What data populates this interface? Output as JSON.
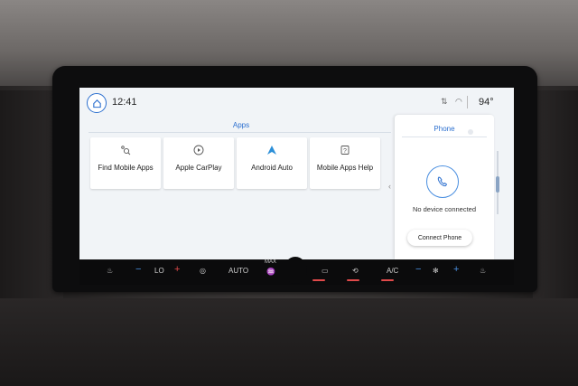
{
  "status_bar": {
    "time": "12:41",
    "temperature": "94°",
    "home_icon": "home-icon",
    "signal_icons": "⇅ ◠"
  },
  "apps_section": {
    "title": "Apps",
    "tiles": [
      {
        "label": "Find Mobile Apps",
        "icon": "search-apps-icon"
      },
      {
        "label": "Apple CarPlay",
        "icon": "play-circle-icon"
      },
      {
        "label": "Android Auto",
        "icon": "android-auto-icon"
      },
      {
        "label": "Mobile Apps Help",
        "icon": "help-icon"
      }
    ]
  },
  "phone_panel": {
    "title": "Phone",
    "status": "No device connected",
    "connect_label": "Connect Phone",
    "icon": "phone-icon"
  },
  "climate_bar": {
    "lo": "LO",
    "auto": "AUTO",
    "max": "MAX",
    "ac": "A/C",
    "minus": "−",
    "plus": "+"
  },
  "colors": {
    "accent": "#2b6fcf",
    "screen_bg": "#f1f4f7"
  }
}
